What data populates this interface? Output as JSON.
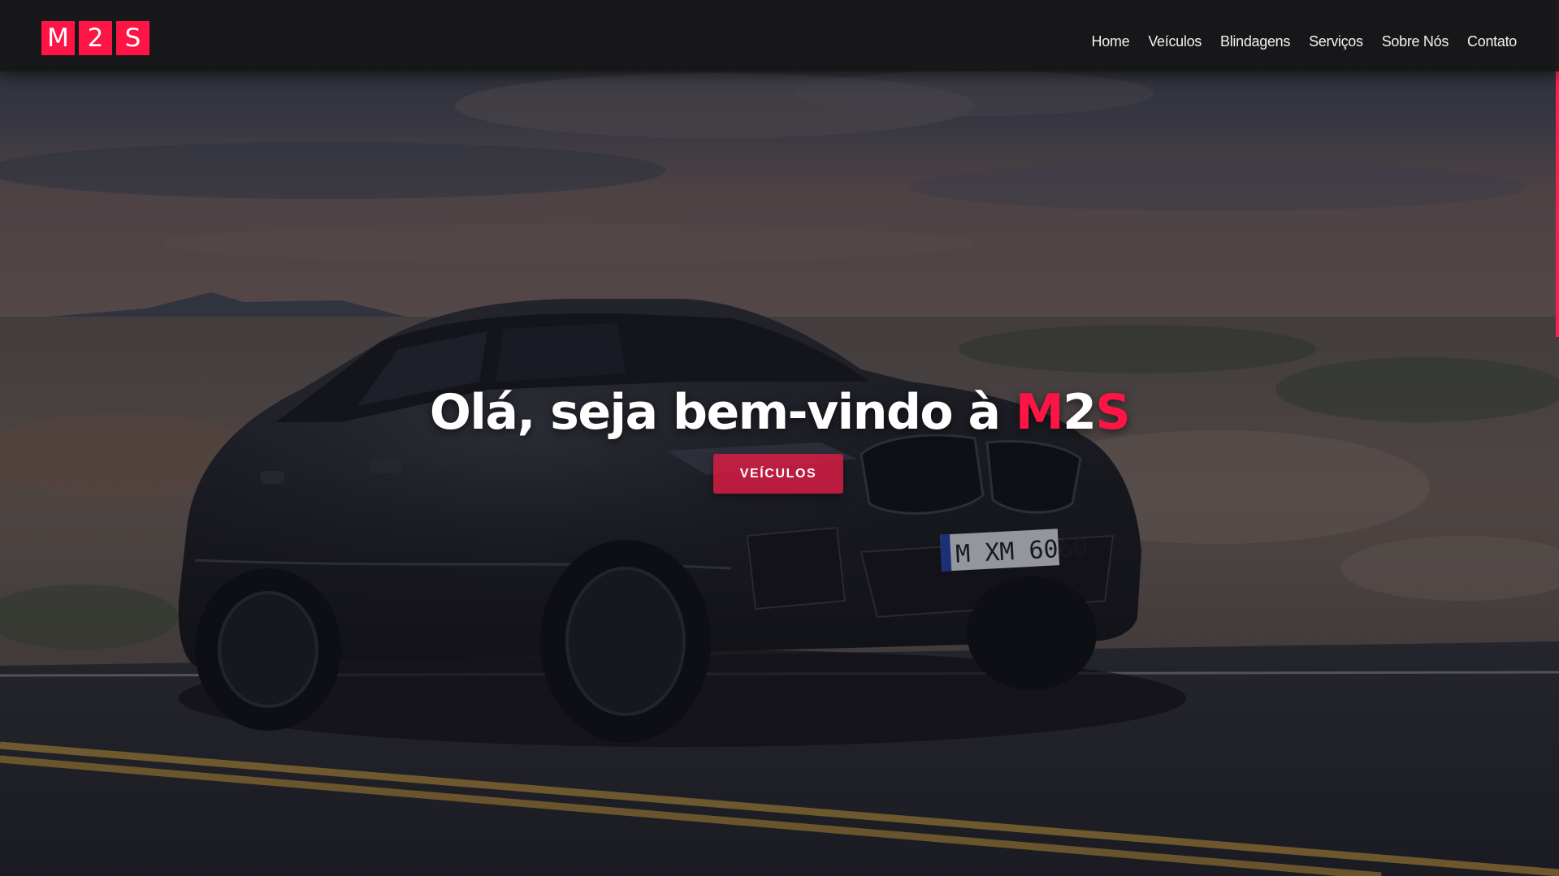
{
  "logo": {
    "letters": [
      "M",
      "2",
      "S"
    ]
  },
  "nav": {
    "items": [
      {
        "label": "Home"
      },
      {
        "label": "Veículos"
      },
      {
        "label": "Blindagens"
      },
      {
        "label": "Serviços"
      },
      {
        "label": "Sobre Nós"
      },
      {
        "label": "Contato"
      }
    ]
  },
  "hero": {
    "headline_prefix": "Olá, seja bem-vindo à ",
    "brand_part1": "M",
    "brand_part2": "2",
    "brand_part3": "S",
    "cta_label": "VEÍCULOS",
    "background_image": "dark-suv-on-desert-road-photo",
    "license_plate": "M XM 6060"
  },
  "colors": {
    "accent": "#ff1446",
    "navbar_bg": "#161618",
    "text": "#ffffff"
  }
}
